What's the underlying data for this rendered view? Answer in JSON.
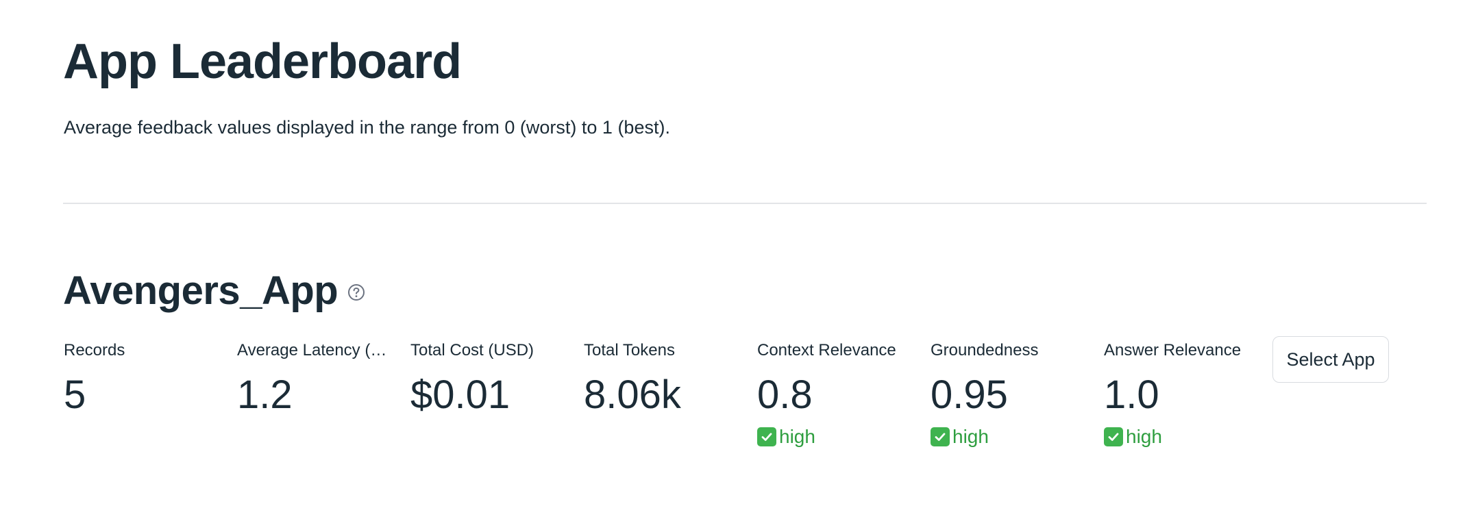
{
  "header": {
    "title": "App Leaderboard",
    "subtitle": "Average feedback values displayed in the range from 0 (worst) to 1 (best)."
  },
  "app": {
    "name": "Avengers_App",
    "help_icon": "question-circle-icon",
    "metrics": [
      {
        "label": "Records",
        "value": "5"
      },
      {
        "label": "Average Latency (Seconds)",
        "value": "1.2"
      },
      {
        "label": "Total Cost (USD)",
        "value": "$0.01"
      },
      {
        "label": "Total Tokens",
        "value": "8.06k"
      },
      {
        "label": "Context Relevance",
        "value": "0.8",
        "delta": "high"
      },
      {
        "label": "Groundedness",
        "value": "0.95",
        "delta": "high"
      },
      {
        "label": "Answer Relevance",
        "value": "1.0",
        "delta": "high"
      }
    ],
    "select_button_label": "Select App"
  },
  "colors": {
    "text": "#1b2b36",
    "positive": "#2e9e3f",
    "divider": "#e3e5e8"
  }
}
